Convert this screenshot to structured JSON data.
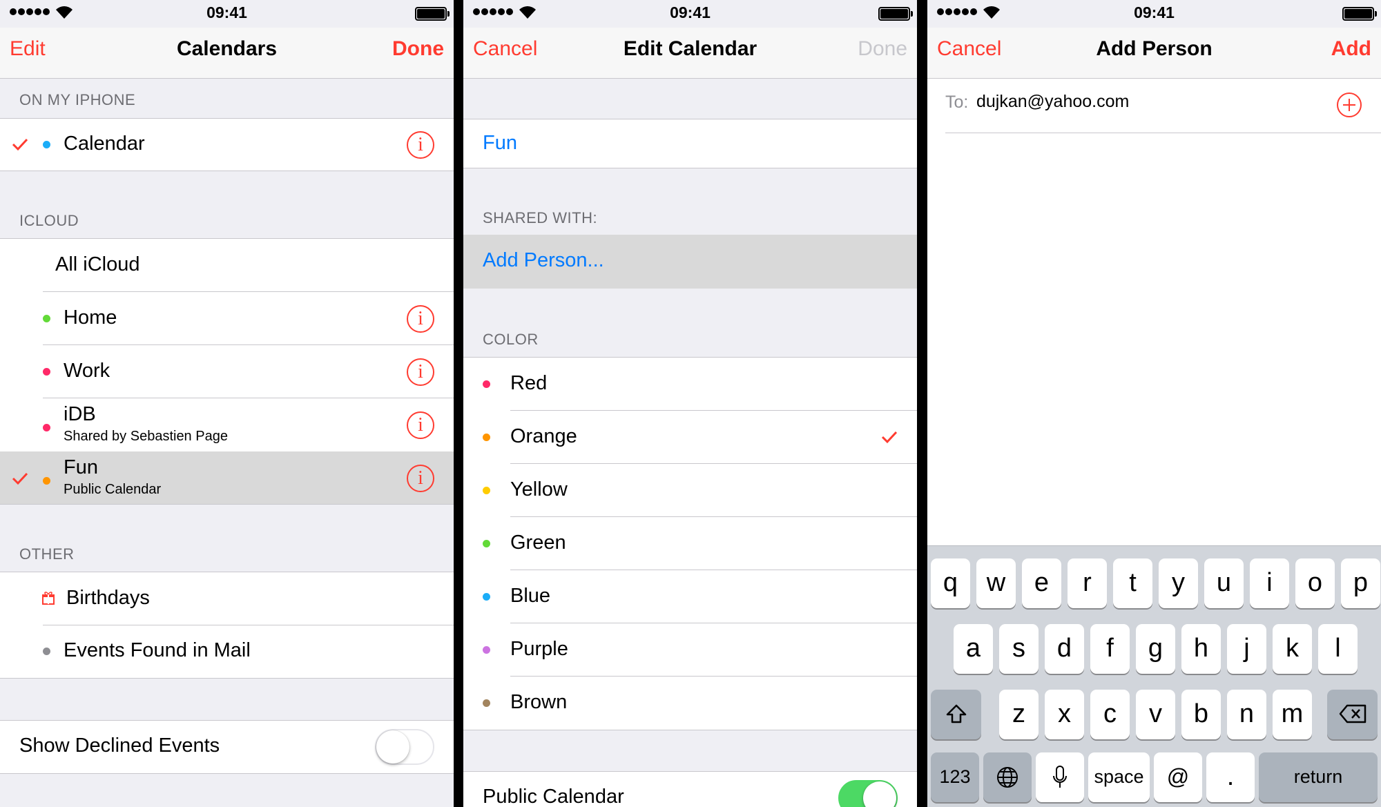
{
  "status_bar": {
    "time": "09:41"
  },
  "panel_calendars": {
    "nav": {
      "left": "Edit",
      "title": "Calendars",
      "right": "Done"
    },
    "sections": {
      "on_my_iphone": "ON MY IPHONE",
      "icloud": "ICLOUD",
      "other": "OTHER"
    },
    "on_my_iphone_items": [
      {
        "label": "Calendar",
        "color": "#1badf8",
        "checked": true
      }
    ],
    "icloud_items": [
      {
        "label": "All iCloud"
      },
      {
        "label": "Home",
        "color": "#63da38"
      },
      {
        "label": "Work",
        "color": "#ff2968"
      },
      {
        "label": "iDB",
        "subtitle": "Shared by Sebastien Page",
        "color": "#ff2968"
      },
      {
        "label": "Fun",
        "subtitle": "Public Calendar",
        "color": "#ff9500",
        "checked": true,
        "selected": true
      }
    ],
    "other_items": [
      {
        "label": "Birthdays",
        "icon": "gift-icon"
      },
      {
        "label": "Events Found in Mail",
        "color": "#8e8e93"
      }
    ],
    "show_declined": {
      "label": "Show Declined Events",
      "on": false
    }
  },
  "panel_edit": {
    "nav": {
      "left": "Cancel",
      "title": "Edit Calendar",
      "right": "Done"
    },
    "calendar_name": "Fun",
    "shared_with_header": "SHARED WITH:",
    "add_person": "Add Person...",
    "color_header": "COLOR",
    "colors": [
      {
        "label": "Red",
        "hex": "#ff2968",
        "checked": false
      },
      {
        "label": "Orange",
        "hex": "#ff9500",
        "checked": true
      },
      {
        "label": "Yellow",
        "hex": "#ffcc00",
        "checked": false
      },
      {
        "label": "Green",
        "hex": "#63da38",
        "checked": false
      },
      {
        "label": "Blue",
        "hex": "#1badf8",
        "checked": false
      },
      {
        "label": "Purple",
        "hex": "#cc73e1",
        "checked": false
      },
      {
        "label": "Brown",
        "hex": "#a2845e",
        "checked": false
      }
    ],
    "public_calendar": {
      "label": "Public Calendar",
      "on": true
    }
  },
  "panel_add_person": {
    "nav": {
      "left": "Cancel",
      "title": "Add Person",
      "right": "Add"
    },
    "to_label": "To:",
    "to_value": "dujkan@yahoo.com",
    "keyboard": {
      "row1": [
        "q",
        "w",
        "e",
        "r",
        "t",
        "y",
        "u",
        "i",
        "o",
        "p"
      ],
      "row2": [
        "a",
        "s",
        "d",
        "f",
        "g",
        "h",
        "j",
        "k",
        "l"
      ],
      "row3": [
        "z",
        "x",
        "c",
        "v",
        "b",
        "n",
        "m"
      ],
      "numbers": "123",
      "space": "space",
      "at": "@",
      "dot": ".",
      "return": "return"
    }
  },
  "colors": {
    "accent": "#ff3b30",
    "link": "#007aff",
    "toggle_on": "#4cd964"
  }
}
